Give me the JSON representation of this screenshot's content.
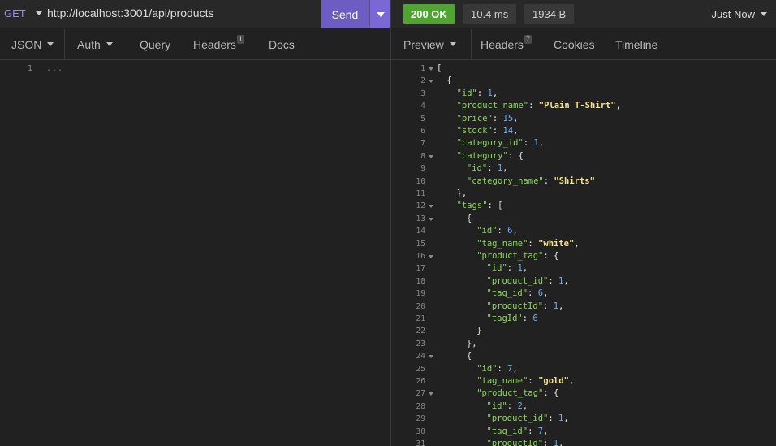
{
  "request": {
    "method": "GET",
    "url": "http://localhost:3001/api/products",
    "send_label": "Send"
  },
  "request_tabs": [
    {
      "label": "JSON"
    },
    {
      "label": "Auth"
    },
    {
      "label": "Query"
    },
    {
      "label": "Headers",
      "badge": "1"
    },
    {
      "label": "Docs"
    }
  ],
  "editor": {
    "line_number": "1",
    "placeholder": "..."
  },
  "response": {
    "status": "200 OK",
    "time": "10.4 ms",
    "size": "1934 B",
    "history_label": "Just Now"
  },
  "response_tabs": [
    {
      "label": "Preview"
    },
    {
      "label": "Headers",
      "badge": "7"
    },
    {
      "label": "Cookies"
    },
    {
      "label": "Timeline"
    }
  ],
  "colors": {
    "accent": "#6d5cc1",
    "status_ok": "#4fa52f",
    "json_key": "#8ed65c",
    "json_string": "#f2e38c",
    "json_number": "#6fb0f2"
  },
  "json_lines": [
    {
      "n": "1",
      "indent": 0,
      "fold": true,
      "tokens": [
        [
          "p",
          "["
        ]
      ]
    },
    {
      "n": "2",
      "indent": 1,
      "fold": true,
      "tokens": [
        [
          "p",
          "{"
        ]
      ]
    },
    {
      "n": "3",
      "indent": 2,
      "fold": false,
      "tokens": [
        [
          "k",
          "\"id\""
        ],
        [
          "p",
          ": "
        ],
        [
          "n",
          "1"
        ],
        [
          "p",
          ","
        ]
      ]
    },
    {
      "n": "4",
      "indent": 2,
      "fold": false,
      "tokens": [
        [
          "k",
          "\"product_name\""
        ],
        [
          "p",
          ": "
        ],
        [
          "s",
          "\"Plain T-Shirt\""
        ],
        [
          "p",
          ","
        ]
      ]
    },
    {
      "n": "5",
      "indent": 2,
      "fold": false,
      "tokens": [
        [
          "k",
          "\"price\""
        ],
        [
          "p",
          ": "
        ],
        [
          "n",
          "15"
        ],
        [
          "p",
          ","
        ]
      ]
    },
    {
      "n": "6",
      "indent": 2,
      "fold": false,
      "tokens": [
        [
          "k",
          "\"stock\""
        ],
        [
          "p",
          ": "
        ],
        [
          "n",
          "14"
        ],
        [
          "p",
          ","
        ]
      ]
    },
    {
      "n": "7",
      "indent": 2,
      "fold": false,
      "tokens": [
        [
          "k",
          "\"category_id\""
        ],
        [
          "p",
          ": "
        ],
        [
          "n",
          "1"
        ],
        [
          "p",
          ","
        ]
      ]
    },
    {
      "n": "8",
      "indent": 2,
      "fold": true,
      "tokens": [
        [
          "k",
          "\"category\""
        ],
        [
          "p",
          ": {"
        ]
      ]
    },
    {
      "n": "9",
      "indent": 3,
      "fold": false,
      "tokens": [
        [
          "k",
          "\"id\""
        ],
        [
          "p",
          ": "
        ],
        [
          "n",
          "1"
        ],
        [
          "p",
          ","
        ]
      ]
    },
    {
      "n": "10",
      "indent": 3,
      "fold": false,
      "tokens": [
        [
          "k",
          "\"category_name\""
        ],
        [
          "p",
          ": "
        ],
        [
          "s",
          "\"Shirts\""
        ]
      ]
    },
    {
      "n": "11",
      "indent": 2,
      "fold": false,
      "tokens": [
        [
          "p",
          "},"
        ]
      ]
    },
    {
      "n": "12",
      "indent": 2,
      "fold": true,
      "tokens": [
        [
          "k",
          "\"tags\""
        ],
        [
          "p",
          ": ["
        ]
      ]
    },
    {
      "n": "13",
      "indent": 3,
      "fold": true,
      "tokens": [
        [
          "p",
          "{"
        ]
      ]
    },
    {
      "n": "14",
      "indent": 4,
      "fold": false,
      "tokens": [
        [
          "k",
          "\"id\""
        ],
        [
          "p",
          ": "
        ],
        [
          "n",
          "6"
        ],
        [
          "p",
          ","
        ]
      ]
    },
    {
      "n": "15",
      "indent": 4,
      "fold": false,
      "tokens": [
        [
          "k",
          "\"tag_name\""
        ],
        [
          "p",
          ": "
        ],
        [
          "s",
          "\"white\""
        ],
        [
          "p",
          ","
        ]
      ]
    },
    {
      "n": "16",
      "indent": 4,
      "fold": true,
      "tokens": [
        [
          "k",
          "\"product_tag\""
        ],
        [
          "p",
          ": {"
        ]
      ]
    },
    {
      "n": "17",
      "indent": 5,
      "fold": false,
      "tokens": [
        [
          "k",
          "\"id\""
        ],
        [
          "p",
          ": "
        ],
        [
          "n",
          "1"
        ],
        [
          "p",
          ","
        ]
      ]
    },
    {
      "n": "18",
      "indent": 5,
      "fold": false,
      "tokens": [
        [
          "k",
          "\"product_id\""
        ],
        [
          "p",
          ": "
        ],
        [
          "n",
          "1"
        ],
        [
          "p",
          ","
        ]
      ]
    },
    {
      "n": "19",
      "indent": 5,
      "fold": false,
      "tokens": [
        [
          "k",
          "\"tag_id\""
        ],
        [
          "p",
          ": "
        ],
        [
          "n",
          "6"
        ],
        [
          "p",
          ","
        ]
      ]
    },
    {
      "n": "20",
      "indent": 5,
      "fold": false,
      "tokens": [
        [
          "k",
          "\"productId\""
        ],
        [
          "p",
          ": "
        ],
        [
          "n",
          "1"
        ],
        [
          "p",
          ","
        ]
      ]
    },
    {
      "n": "21",
      "indent": 5,
      "fold": false,
      "tokens": [
        [
          "k",
          "\"tagId\""
        ],
        [
          "p",
          ": "
        ],
        [
          "n",
          "6"
        ]
      ]
    },
    {
      "n": "22",
      "indent": 4,
      "fold": false,
      "tokens": [
        [
          "p",
          "}"
        ]
      ]
    },
    {
      "n": "23",
      "indent": 3,
      "fold": false,
      "tokens": [
        [
          "p",
          "},"
        ]
      ]
    },
    {
      "n": "24",
      "indent": 3,
      "fold": true,
      "tokens": [
        [
          "p",
          "{"
        ]
      ]
    },
    {
      "n": "25",
      "indent": 4,
      "fold": false,
      "tokens": [
        [
          "k",
          "\"id\""
        ],
        [
          "p",
          ": "
        ],
        [
          "n",
          "7"
        ],
        [
          "p",
          ","
        ]
      ]
    },
    {
      "n": "26",
      "indent": 4,
      "fold": false,
      "tokens": [
        [
          "k",
          "\"tag_name\""
        ],
        [
          "p",
          ": "
        ],
        [
          "s",
          "\"gold\""
        ],
        [
          "p",
          ","
        ]
      ]
    },
    {
      "n": "27",
      "indent": 4,
      "fold": true,
      "tokens": [
        [
          "k",
          "\"product_tag\""
        ],
        [
          "p",
          ": {"
        ]
      ]
    },
    {
      "n": "28",
      "indent": 5,
      "fold": false,
      "tokens": [
        [
          "k",
          "\"id\""
        ],
        [
          "p",
          ": "
        ],
        [
          "n",
          "2"
        ],
        [
          "p",
          ","
        ]
      ]
    },
    {
      "n": "29",
      "indent": 5,
      "fold": false,
      "tokens": [
        [
          "k",
          "\"product_id\""
        ],
        [
          "p",
          ": "
        ],
        [
          "n",
          "1"
        ],
        [
          "p",
          ","
        ]
      ]
    },
    {
      "n": "30",
      "indent": 5,
      "fold": false,
      "tokens": [
        [
          "k",
          "\"tag_id\""
        ],
        [
          "p",
          ": "
        ],
        [
          "n",
          "7"
        ],
        [
          "p",
          ","
        ]
      ]
    },
    {
      "n": "31",
      "indent": 5,
      "fold": false,
      "tokens": [
        [
          "k",
          "\"productId\""
        ],
        [
          "p",
          ": "
        ],
        [
          "n",
          "1"
        ],
        [
          "p",
          ","
        ]
      ]
    }
  ]
}
